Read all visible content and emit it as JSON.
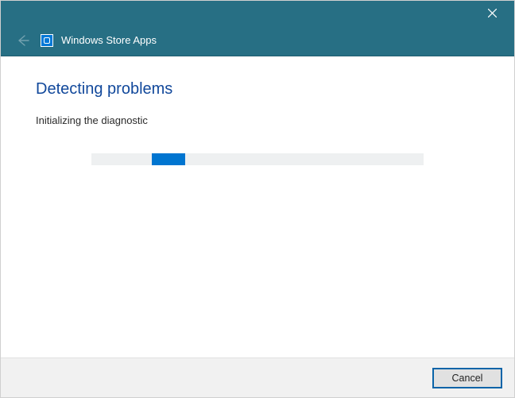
{
  "header": {
    "title": "Windows Store Apps",
    "app_icon": "store-icon"
  },
  "main": {
    "heading": "Detecting problems",
    "status": "Initializing the diagnostic"
  },
  "footer": {
    "cancel_label": "Cancel"
  }
}
